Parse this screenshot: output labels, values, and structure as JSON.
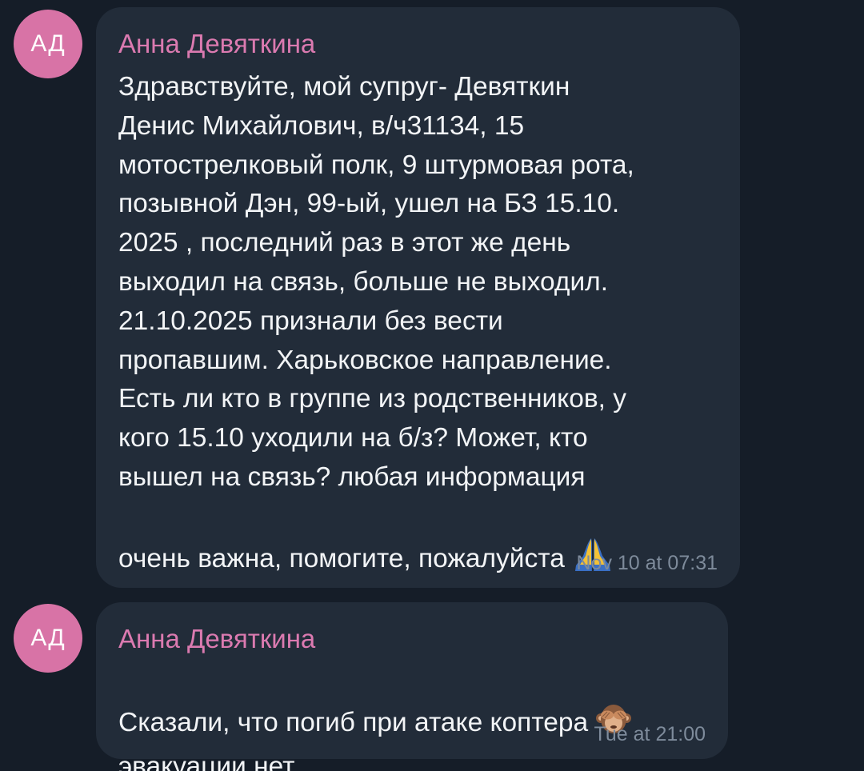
{
  "messages": [
    {
      "avatar_initials": "АД",
      "sender": "Анна Девяткина",
      "text": "Здравствуйте, мой супруг- Девяткин\nДенис Михайлович,  в/ч31134, 15\nмотострелковый полк, 9 штурмовая рота,\nпозывной Дэн, 99-ый, ушел на БЗ 15.10.\n2025 , последний раз в этот же день\nвыходил на связь, больше не выходил.\n21.10.2025 признали без вести\nпропавшим. Харьковское направление.\nЕсть ли кто в группе из родственников, у\nкого 15.10 уходили на б/з? Может, кто\nвышел на связь? любая информация\nочень важна, помогите, пожалуйста ",
      "emoji": "folded-hands",
      "time": "Nov 10 at 07:31"
    },
    {
      "avatar_initials": "АД",
      "sender": "Анна Девяткина",
      "text": "Сказали, что погиб при атаке коптера ",
      "emoji": "see-no-evil-monkey",
      "text2": "эвакуации нет",
      "time": "Tue at 21:00"
    }
  ],
  "colors": {
    "background": "#151d28",
    "bubble": "#222c39",
    "avatar": "#d873a6",
    "sender_name": "#db7ab0",
    "message_text": "#f2f4f6",
    "timestamp": "#7e8b9b"
  }
}
